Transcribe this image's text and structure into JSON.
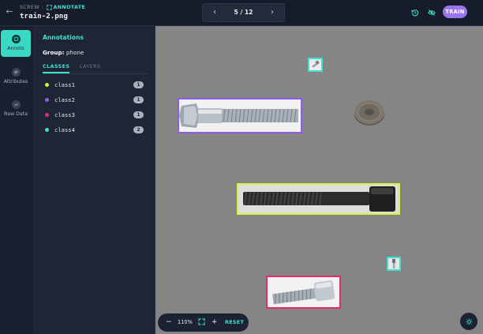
{
  "header": {
    "project": "SCREW",
    "mode": "ANNOTATE",
    "filename": "train-2.png",
    "pager": {
      "current": 5,
      "total": 12,
      "label": "5 / 12"
    },
    "train_label": "TRAIN"
  },
  "rail": {
    "items": [
      {
        "label": "Annots",
        "icon": "annotations-icon",
        "active": true
      },
      {
        "label": "Attributes",
        "icon": "attributes-icon",
        "active": false
      },
      {
        "label": "Raw Data",
        "icon": "raw-data-icon",
        "active": false
      }
    ]
  },
  "panel": {
    "title": "Annotations",
    "group_label": "Group:",
    "group_value": "phone",
    "tabs": [
      {
        "label": "CLASSES",
        "active": true
      },
      {
        "label": "LAYERS",
        "active": false
      }
    ],
    "classes": [
      {
        "name": "class1",
        "color": "#d8f53a",
        "count": "1"
      },
      {
        "name": "class2",
        "color": "#8a5cf0",
        "count": "1"
      },
      {
        "name": "class3",
        "color": "#e8286b",
        "count": "1"
      },
      {
        "name": "class4",
        "color": "#3fe0cf",
        "count": "2"
      }
    ]
  },
  "canvas": {
    "zoom": "110%",
    "reset_label": "RESET",
    "annotations": [
      {
        "class": "class4",
        "color": "#3fe0cf",
        "object": "small screw"
      },
      {
        "class": "class2",
        "color": "#8a5cf0",
        "object": "hex bolt"
      },
      {
        "class": "class1",
        "color": "#d8f53a",
        "object": "black socket screw"
      },
      {
        "class": "class4",
        "color": "#3fe0cf",
        "object": "small screw"
      },
      {
        "class": "class3",
        "color": "#e8286b",
        "object": "socket screw"
      }
    ]
  },
  "colors": {
    "accent": "#3fe0cf",
    "train": "#9a75ee",
    "canvas_bg": "#858585"
  }
}
